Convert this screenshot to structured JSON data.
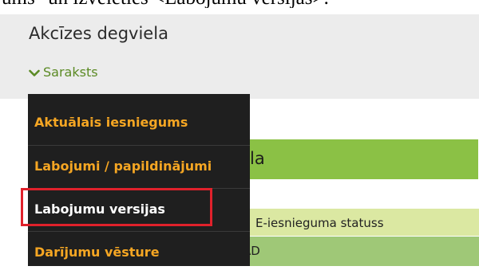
{
  "doc_text": {
    "left_fragment": "ums\" un izvēlēties <Labojumu versijas>.",
    "right_fragment": ""
  },
  "panel": {
    "title": "Akcīzes degviela",
    "list_toggle_label": "Saraksts",
    "list_toggle_icon": "chevron-down-icon"
  },
  "colors": {
    "menu_bg": "#1f1f1f",
    "menu_item_accent": "#f5a623",
    "menu_item_active": "#ffffff",
    "highlight": "#e0212b",
    "green_button": "#8bc145",
    "table_header": "#dbe8a2",
    "table_row": "#9fc877"
  },
  "menu": {
    "items": [
      {
        "label": "Aktuālais iesniegums",
        "active": false
      },
      {
        "label": "Labojumi / papildinājumi",
        "active": false
      },
      {
        "label": "Labojumu versijas",
        "active": true
      },
      {
        "label": "Darījumu vēsture",
        "active": false
      }
    ]
  },
  "background": {
    "button_text_fragment": "la",
    "table_header_text": "E-iesnieguma statuss",
    "table_row_text": "AD"
  }
}
